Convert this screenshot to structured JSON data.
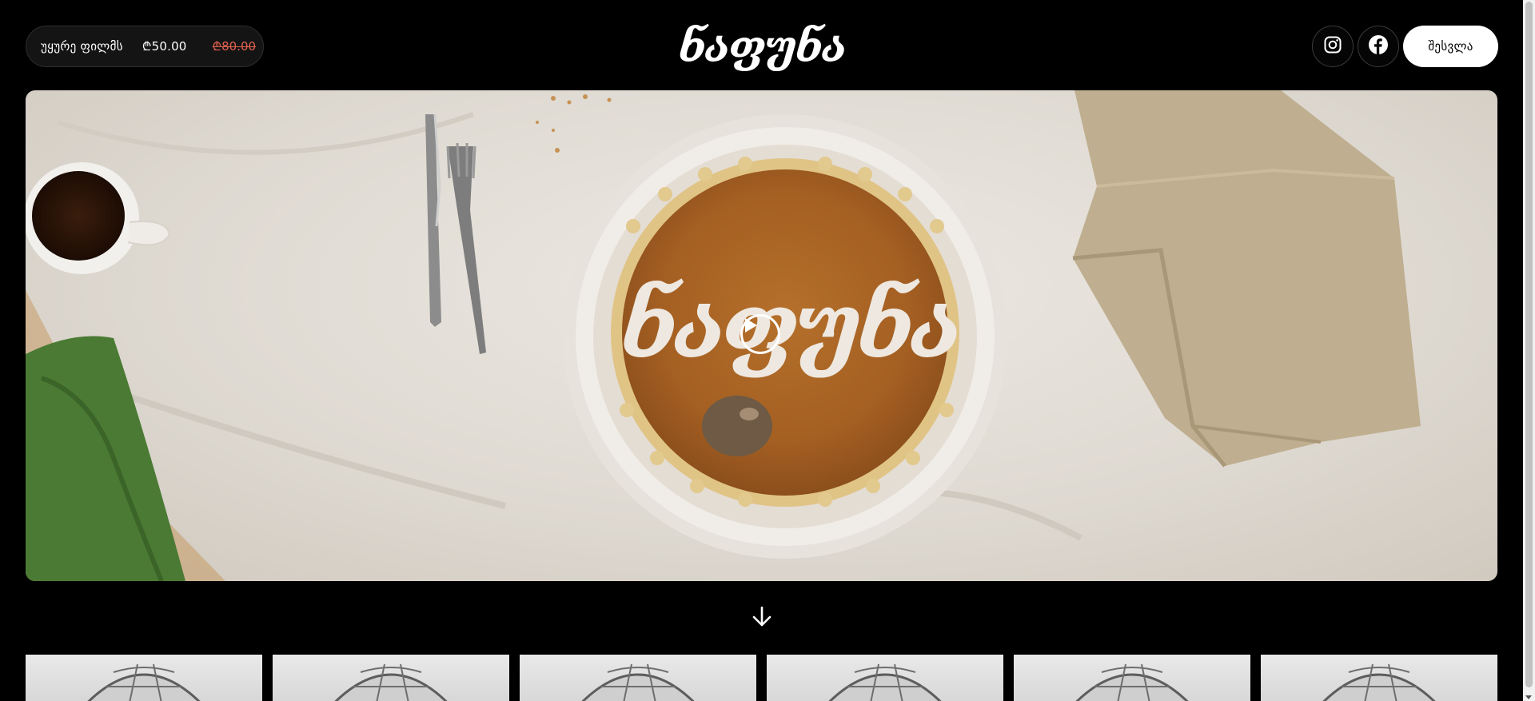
{
  "header": {
    "buy": {
      "label": "უყურე ფილმს",
      "price_now": "₾50.00",
      "price_old": "₾80.00"
    },
    "logo_text": "ნაფუნა",
    "social": [
      {
        "name": "instagram",
        "icon": "instagram-icon"
      },
      {
        "name": "facebook",
        "icon": "facebook-icon"
      }
    ],
    "login_label": "შესვლა"
  },
  "hero": {
    "pie_text": "ნაფუნა",
    "play_icon": "play-icon"
  },
  "scroll_icon": "arrow-down-icon",
  "thumbnails_count": 6,
  "colors": {
    "background": "#000000",
    "strike_price": "#e0614f",
    "button_bg": "#ffffff"
  }
}
